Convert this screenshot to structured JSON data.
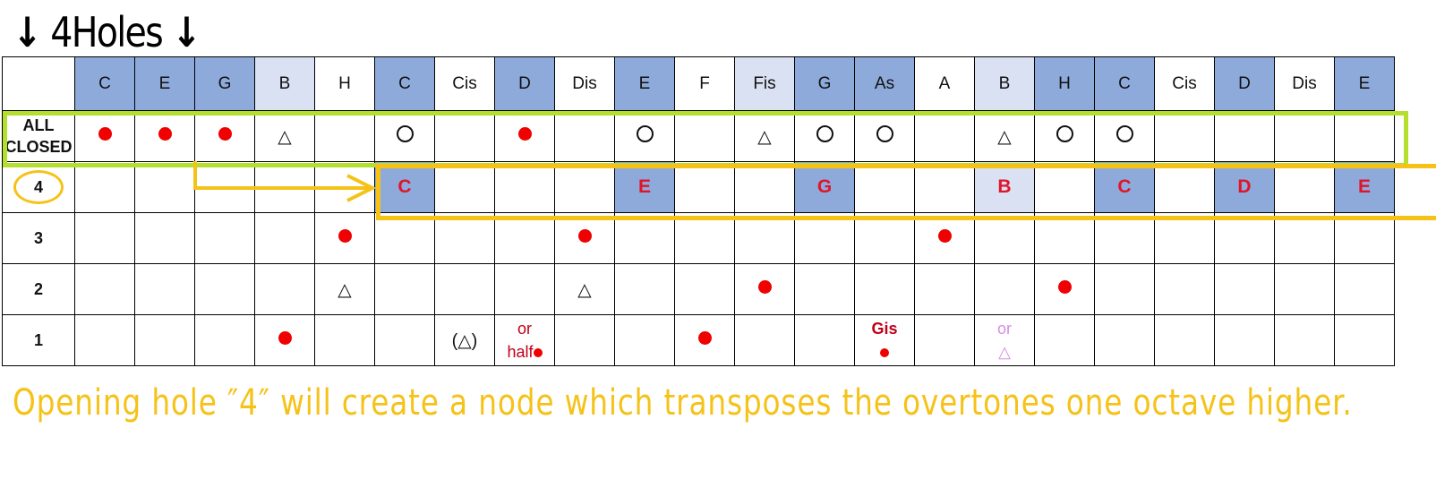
{
  "title": {
    "left_arrow": "↓",
    "text": "4Holes",
    "right_arrow": "↓"
  },
  "colors": {
    "header_dark": "#8eaadb",
    "header_light": "#d9e1f3",
    "red_dot": "#f00000",
    "green_box": "#b4df2e",
    "yellow_box": "#f5c218",
    "red_note_text": "#e0152a"
  },
  "header": {
    "notes": [
      {
        "name": "C",
        "shade": "dark"
      },
      {
        "name": "E",
        "shade": "dark"
      },
      {
        "name": "G",
        "shade": "dark"
      },
      {
        "name": "B",
        "shade": "light"
      },
      {
        "name": "H",
        "shade": "none"
      },
      {
        "name": "C",
        "shade": "dark"
      },
      {
        "name": "Cis",
        "shade": "none"
      },
      {
        "name": "D",
        "shade": "dark"
      },
      {
        "name": "Dis",
        "shade": "none"
      },
      {
        "name": "E",
        "shade": "dark"
      },
      {
        "name": "F",
        "shade": "none"
      },
      {
        "name": "Fis",
        "shade": "light"
      },
      {
        "name": "G",
        "shade": "dark"
      },
      {
        "name": "As",
        "shade": "dark"
      },
      {
        "name": "A",
        "shade": "none"
      },
      {
        "name": "B",
        "shade": "light"
      },
      {
        "name": "H",
        "shade": "dark"
      },
      {
        "name": "C",
        "shade": "dark"
      },
      {
        "name": "Cis",
        "shade": "none"
      },
      {
        "name": "D",
        "shade": "dark"
      },
      {
        "name": "Dis",
        "shade": "none"
      },
      {
        "name": "E",
        "shade": "dark"
      }
    ]
  },
  "legend_symbols": {
    "dot": "red dot",
    "circle": "○",
    "triangle": "△"
  },
  "rows": [
    {
      "label": "ALL CLOSED",
      "label_lines": [
        "ALL",
        "CLOSED"
      ],
      "cells": [
        "dot",
        "dot",
        "dot",
        "tri",
        "",
        "circ",
        "",
        "dot",
        "",
        "circ",
        "",
        "tri",
        "circ",
        "circ",
        "",
        "tri",
        "circ",
        "circ",
        "",
        "",
        "",
        ""
      ]
    },
    {
      "label": "4",
      "label_circled": true,
      "cells": [
        "",
        "",
        "",
        "",
        "",
        {
          "text": "C",
          "shade": "dark"
        },
        "",
        "",
        "",
        {
          "text": "E",
          "shade": "dark"
        },
        "",
        "",
        {
          "text": "G",
          "shade": "dark"
        },
        "",
        "",
        {
          "text": "B",
          "shade": "light"
        },
        "",
        {
          "text": "C",
          "shade": "dark"
        },
        "",
        {
          "text": "D",
          "shade": "dark"
        },
        "",
        {
          "text": "E",
          "shade": "dark"
        }
      ]
    },
    {
      "label": "3",
      "cells": [
        "",
        "",
        "",
        "",
        "dot",
        "",
        "",
        "",
        "dot",
        "",
        "",
        "",
        "",
        "",
        "dot",
        "",
        "",
        "",
        "",
        "",
        "",
        ""
      ]
    },
    {
      "label": "2",
      "cells": [
        "",
        "",
        "",
        "",
        "tri",
        "",
        "",
        "",
        "tri",
        "",
        "",
        "dot",
        "",
        "",
        "",
        "",
        "dot",
        "",
        "",
        "",
        "",
        ""
      ]
    },
    {
      "label": "1",
      "cells": [
        "",
        "",
        "",
        "dot",
        "",
        "",
        {
          "kind": "paren-tri",
          "text": "(△)"
        },
        {
          "kind": "or-half",
          "line1": "or",
          "line2": "half"
        },
        "",
        "",
        "dot",
        "",
        "",
        {
          "kind": "gis",
          "line1": "Gis"
        },
        "",
        {
          "kind": "or-tri",
          "line1": "or",
          "line2": "△"
        },
        "",
        "",
        "",
        "",
        "",
        ""
      ]
    }
  ],
  "caption": "Opening hole ″4″ will create a node which transposes the overtones one octave higher."
}
